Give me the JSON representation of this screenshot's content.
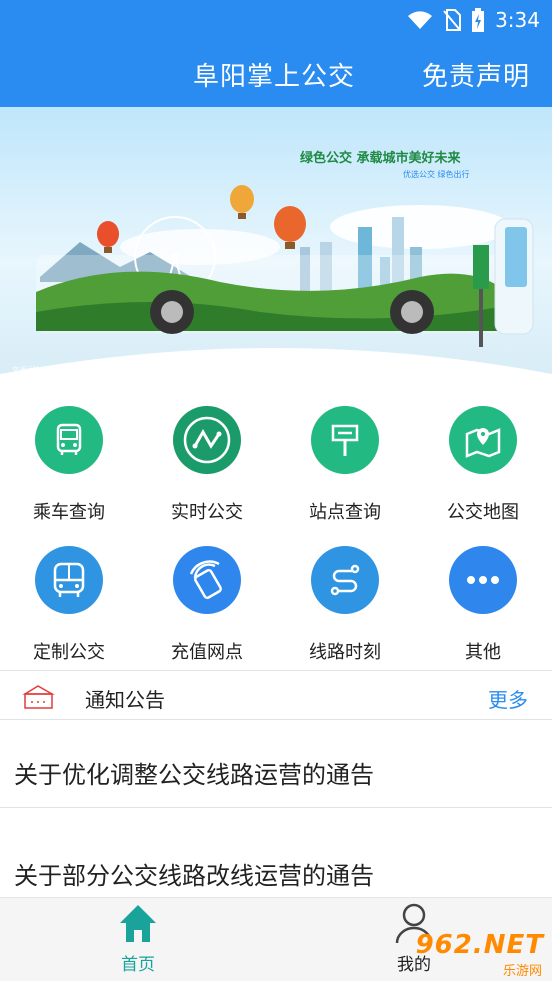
{
  "status": {
    "time": "3:34"
  },
  "header": {
    "title": "阜阳掌上公交",
    "right_link": "免责声明"
  },
  "banner": {
    "slogan": "绿色公交 承载城市美好未来",
    "sub": "优选公交 绿色出行",
    "corner_text": "交通运输部"
  },
  "grid": [
    {
      "label": "乘车查询",
      "icon": "bus-front-icon",
      "color": "#22b983"
    },
    {
      "label": "实时公交",
      "icon": "realtime-route-icon",
      "color": "#1c9b6a"
    },
    {
      "label": "站点查询",
      "icon": "bus-stop-sign-icon",
      "color": "#22b983"
    },
    {
      "label": "公交地图",
      "icon": "map-pin-icon",
      "color": "#22b983"
    },
    {
      "label": "定制公交",
      "icon": "bus-icon",
      "color": "#2f95e3"
    },
    {
      "label": "充值网点",
      "icon": "nfc-card-icon",
      "color": "#2f87ee"
    },
    {
      "label": "线路时刻",
      "icon": "route-path-icon",
      "color": "#2f95e3"
    },
    {
      "label": "其他",
      "icon": "more-dots-icon",
      "color": "#2f87ee"
    }
  ],
  "notice": {
    "title": "通知公告",
    "more": "更多"
  },
  "news": [
    "关于优化调整公交线路运营的通告",
    "关于部分公交线路改线运营的通告"
  ],
  "nav": {
    "home": "首页",
    "mine": "我的"
  },
  "watermark": {
    "text": "962.NET",
    "sub": "乐游网"
  },
  "colors": {
    "primary": "#2a8cf0",
    "green": "#22b983",
    "nav_active": "#1aa39a"
  }
}
